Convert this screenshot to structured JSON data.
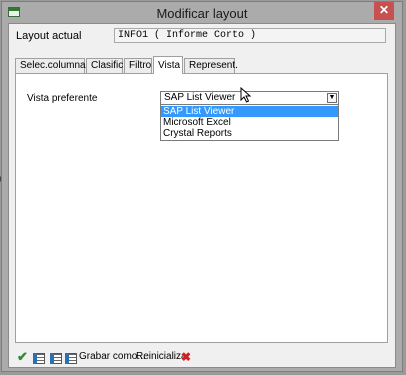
{
  "window": {
    "title": "Modificar layout",
    "close_symbol": "✕"
  },
  "layout": {
    "label": "Layout actual",
    "value": "INFO1 ( Informe Corto )"
  },
  "tabs": [
    {
      "label": "Selec.columnas",
      "active": false
    },
    {
      "label": "Clasific.",
      "active": false
    },
    {
      "label": "Filtro",
      "active": false
    },
    {
      "label": "Vista",
      "active": true
    },
    {
      "label": "Represent.",
      "active": false
    }
  ],
  "vista": {
    "label": "Vista preferente",
    "selected": "SAP List Viewer",
    "options": [
      "SAP List Viewer",
      "Microsoft Excel",
      "Crystal Reports"
    ]
  },
  "footer": {
    "save_as_label": "Grabar como...",
    "reset_label": "Reinicializar",
    "icons": [
      "check-icon",
      "grid-icon",
      "grid-icon",
      "grid-icon",
      "cancel-icon"
    ]
  },
  "colors": {
    "selection": "#3399ff",
    "close": "#c75050",
    "check": "#2e8b2e",
    "cancel": "#d21f1f"
  }
}
